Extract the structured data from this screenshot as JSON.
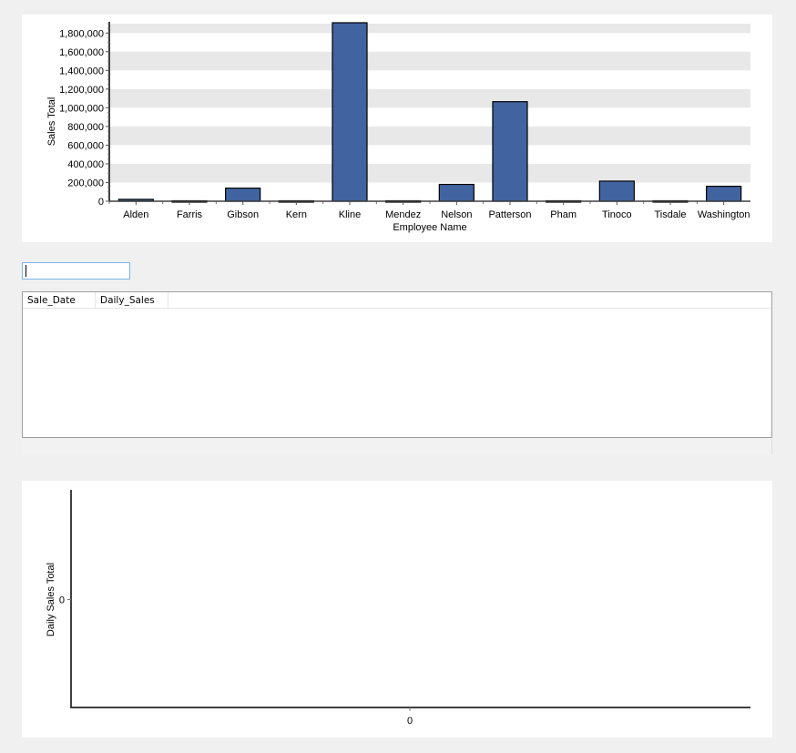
{
  "chart_data": [
    {
      "type": "bar",
      "title": "",
      "xlabel": "Employee Name",
      "ylabel": "Sales Total",
      "categories": [
        "Alden",
        "Farris",
        "Gibson",
        "Kern",
        "Kline",
        "Mendez",
        "Nelson",
        "Patterson",
        "Pham",
        "Tinoco",
        "Tisdale",
        "Washington"
      ],
      "values": [
        20000,
        5000,
        140000,
        5000,
        1910000,
        5000,
        180000,
        1065000,
        5000,
        215000,
        5000,
        160000
      ],
      "ylim": [
        0,
        1900000
      ],
      "yticks": [
        0,
        200000,
        400000,
        600000,
        800000,
        1000000,
        1200000,
        1400000,
        1600000,
        1800000
      ],
      "ytick_labels": [
        "0",
        "200,000",
        "400,000",
        "600,000",
        "800,000",
        "1,000,000",
        "1,200,000",
        "1,400,000",
        "1,600,000",
        "1,800,000"
      ],
      "grid": "alternating horizontal bands",
      "bar_color": "#4164a0",
      "band_color": "#e8e8e8"
    },
    {
      "type": "line",
      "title": "",
      "xlabel": "",
      "ylabel": "Daily Sales Total",
      "x": [],
      "values": [],
      "xtick_labels": [
        "0"
      ],
      "ytick_labels": [
        "0"
      ]
    }
  ],
  "filter": {
    "value": "",
    "placeholder": ""
  },
  "table": {
    "columns": [
      "Sale_Date",
      "Daily_Sales"
    ],
    "rows": []
  }
}
